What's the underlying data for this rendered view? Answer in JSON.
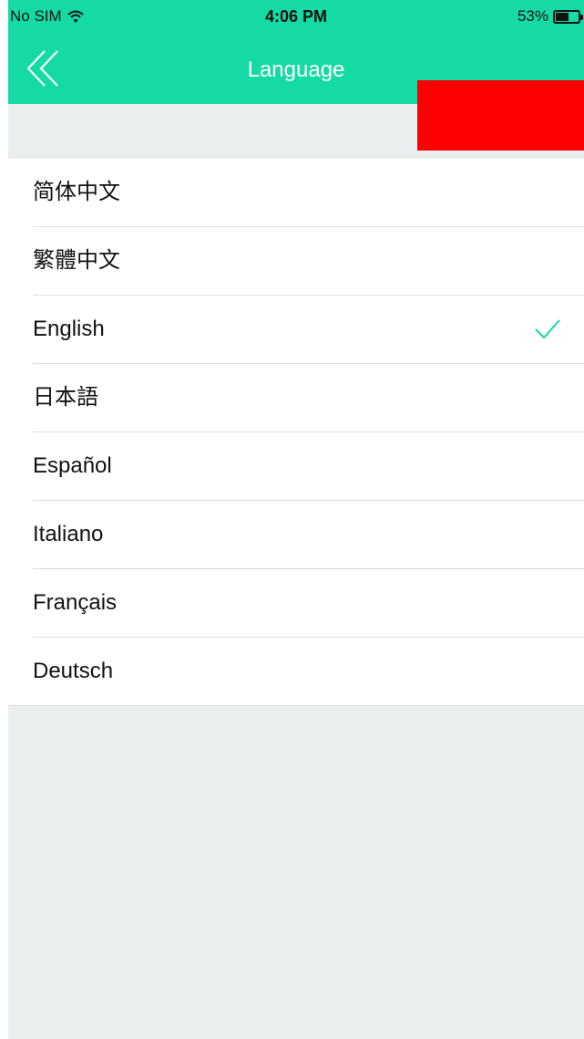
{
  "status_bar": {
    "carrier": "No SIM",
    "time": "4:06 PM",
    "battery_percent": "53%",
    "battery_level": 0.53
  },
  "nav": {
    "title": "Language",
    "back_icon": "double-chevron-left-icon"
  },
  "languages": [
    {
      "label": "简体中文",
      "selected": false
    },
    {
      "label": "繁體中文",
      "selected": false
    },
    {
      "label": "English",
      "selected": true
    },
    {
      "label": "日本語",
      "selected": false
    },
    {
      "label": "Español",
      "selected": false
    },
    {
      "label": "Italiano",
      "selected": false
    },
    {
      "label": "Français",
      "selected": false
    },
    {
      "label": "Deutsch",
      "selected": false
    }
  ],
  "colors": {
    "accent": "#13dba3",
    "background": "#eceff0",
    "redaction": "#ff0000"
  }
}
